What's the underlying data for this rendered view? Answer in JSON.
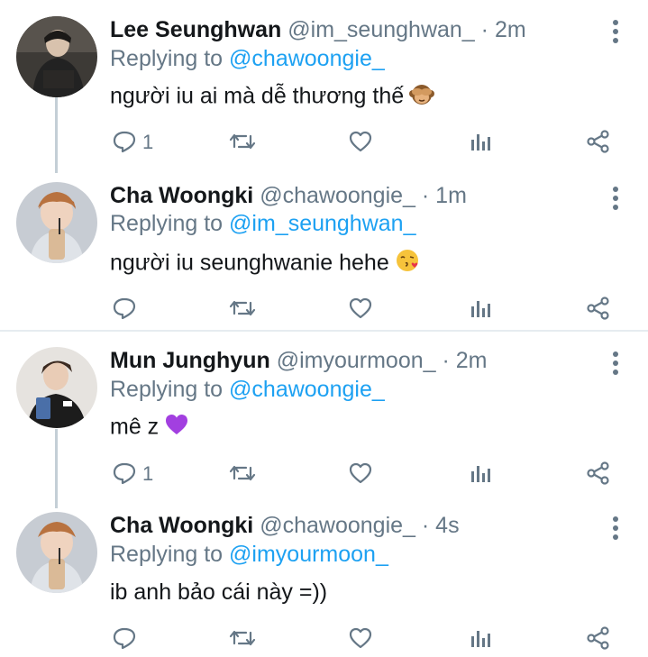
{
  "tweets": [
    {
      "name": "Lee Seunghwan",
      "handle": "@im_seunghwan_",
      "dot": "·",
      "time": "2m",
      "replying_label": "Replying to",
      "replying_to": "@chawoongie_",
      "text": "người iu ai mà dễ thương thế",
      "emoji": "see-no-evil-monkey",
      "reply_count": "1"
    },
    {
      "name": "Cha Woongki",
      "handle": "@chawoongie_",
      "dot": "·",
      "time": "1m",
      "replying_label": "Replying to",
      "replying_to": "@im_seunghwan_",
      "text": "người iu seunghwanie hehe",
      "emoji": "face-blowing-kiss",
      "reply_count": ""
    },
    {
      "name": "Mun Junghyun",
      "handle": "@imyourmoon_",
      "dot": "·",
      "time": "2m",
      "replying_label": "Replying to",
      "replying_to": "@chawoongie_",
      "text": "mê z",
      "emoji": "purple-heart",
      "reply_count": "1"
    },
    {
      "name": "Cha Woongki",
      "handle": "@chawoongie_",
      "dot": "·",
      "time": "4s",
      "replying_label": "Replying to",
      "replying_to": "@imyourmoon_",
      "text": "ib anh bảo cái này =))",
      "emoji": "",
      "reply_count": ""
    }
  ],
  "colors": {
    "link": "#1da1f2",
    "secondary": "#657786",
    "primary": "#14171a",
    "thread_line": "#c4cfd6"
  },
  "icons": [
    "reply-icon",
    "retweet-icon",
    "like-icon",
    "analytics-icon",
    "share-icon",
    "more-icon"
  ]
}
